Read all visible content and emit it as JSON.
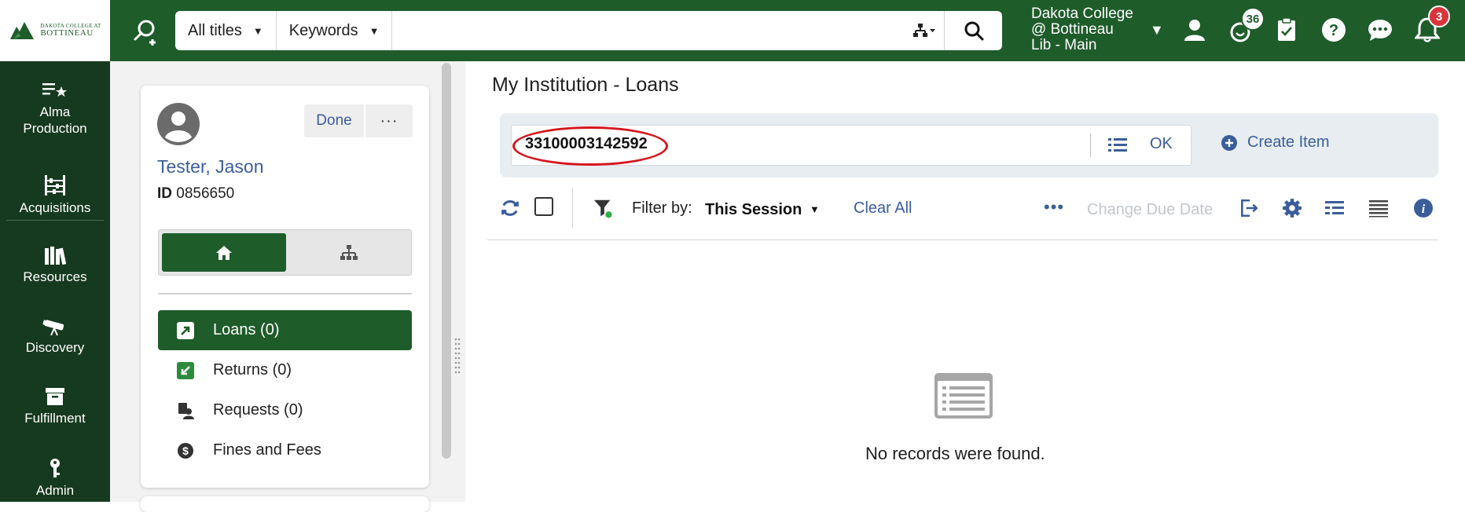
{
  "header": {
    "logo_line1": "DAKOTA COLLEGE AT",
    "logo_line2": "BOTTINEAU",
    "search": {
      "type_label": "All titles",
      "field_label": "Keywords",
      "query": ""
    },
    "institution": [
      "Dakota College",
      "@ Bottineau",
      "Lib - Main"
    ],
    "tasks_count": "36",
    "notifications_count": "3"
  },
  "nav": {
    "items": [
      {
        "label_line1": "Alma",
        "label_line2": "Production",
        "icon": "star-list-icon"
      },
      {
        "label_line1": "Acquisitions",
        "label_line2": "",
        "icon": "abacus-icon"
      },
      {
        "label_line1": "Resources",
        "label_line2": "",
        "icon": "books-icon"
      },
      {
        "label_line1": "Discovery",
        "label_line2": "",
        "icon": "telescope-icon"
      },
      {
        "label_line1": "Fulfillment",
        "label_line2": "",
        "icon": "archive-box-icon"
      },
      {
        "label_line1": "Admin",
        "label_line2": "",
        "icon": "key-icon"
      }
    ]
  },
  "patron": {
    "done_label": "Done",
    "more_label": "···",
    "name": "Tester, Jason",
    "id_label": "ID",
    "id_value": "0856650",
    "actions": [
      {
        "label": "Loans (0)",
        "icon": "loan-arrow-icon",
        "active": true
      },
      {
        "label": "Returns (0)",
        "icon": "return-arrow-icon",
        "active": false
      },
      {
        "label": "Requests (0)",
        "icon": "request-icon",
        "active": false
      },
      {
        "label": "Fines and Fees",
        "icon": "dollar-icon",
        "active": false
      }
    ]
  },
  "main": {
    "title": "My Institution - Loans",
    "scan": {
      "value": "33100003142592",
      "ok_label": "OK",
      "create_item_label": "Create Item"
    },
    "toolbar": {
      "filter_label": "Filter by:",
      "filter_value": "This Session",
      "clear_all": "Clear All",
      "change_due_date": "Change Due Date"
    },
    "empty_message": "No records were found."
  },
  "colors": {
    "brand_green": "#1e5c2a",
    "nav_dark": "#163a1f",
    "link_blue": "#3b5e9b",
    "highlight_red": "#d6151d",
    "badge_red": "#d9343a"
  }
}
